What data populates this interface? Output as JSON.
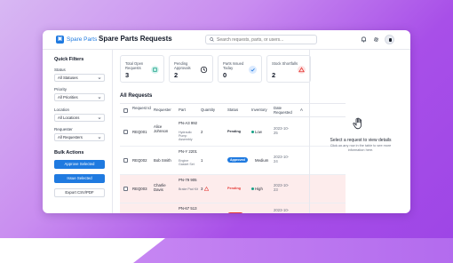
{
  "header": {
    "logo_text": "Spare Parts",
    "title": "Spare Parts Requests",
    "search_placeholder": "Search requests, parts, or users..."
  },
  "sidebar": {
    "quick_filters_title": "Quick Filters",
    "filters": [
      {
        "label": "Status",
        "value": "All Statuses"
      },
      {
        "label": "Priority",
        "value": "All Priorities"
      },
      {
        "label": "Location",
        "value": "All Locations"
      },
      {
        "label": "Requester",
        "value": "All Requesters"
      }
    ],
    "bulk_title": "Bulk Actions",
    "approve_label": "Approve Selected",
    "issue_label": "Issue Selected",
    "export_label": "Export CSV/PDF"
  },
  "stats": [
    {
      "label": "Total Open Requests",
      "value": "3",
      "icon": "box-icon",
      "color": "#d6f3ee"
    },
    {
      "label": "Pending Approvals",
      "value": "2",
      "icon": "clock-icon",
      "color": "#ffffff"
    },
    {
      "label": "Parts Issued Today",
      "value": "0",
      "icon": "check-icon",
      "color": "#dbeafe"
    },
    {
      "label": "Stock Shortfalls",
      "value": "2",
      "icon": "warning-icon",
      "color": "#fde2e2"
    }
  ],
  "table": {
    "title": "All Requests",
    "columns": [
      "Request Id",
      "Requester",
      "Part",
      "Quantity",
      "Status",
      "Inventory",
      "Date Requested",
      "A"
    ],
    "rows": [
      {
        "id": "REQ001",
        "requester": "Alice Johnson",
        "part": "PN-A3 992",
        "part_desc": "Hydraulic Pump Assembly",
        "qty": "2",
        "status": "Pending",
        "inventory": "Low",
        "date": "2023-10-25",
        "alert": false
      },
      {
        "id": "REQ002",
        "requester": "Bob Smith",
        "part": "PN-Y 2201",
        "part_desc": "Engine Gasket Set",
        "qty": "1",
        "status": "Approved",
        "inventory": "Medium",
        "date": "2023-10-24",
        "alert": false
      },
      {
        "id": "REQ003",
        "requester": "Charlie Davis",
        "part": "PN-79 905",
        "part_desc": "Brake Pad Kit",
        "qty": "3",
        "status": "Pending",
        "inventory": "High",
        "date": "2023-10-23",
        "alert": true
      },
      {
        "id": "REQ004",
        "requester": "",
        "part": "PN-67 513",
        "part_desc": "",
        "qty": "",
        "status": "",
        "inventory": "",
        "date": "2023-10-",
        "alert": true
      }
    ]
  },
  "detail": {
    "empty_title": "Select a request to view details",
    "empty_sub": "Click on any row in the table to see more information here."
  },
  "colors": {
    "accent": "#1f7ae0",
    "pending": "#e53935",
    "approved": "#1f7ae0",
    "alert_row": "#fdecec"
  }
}
